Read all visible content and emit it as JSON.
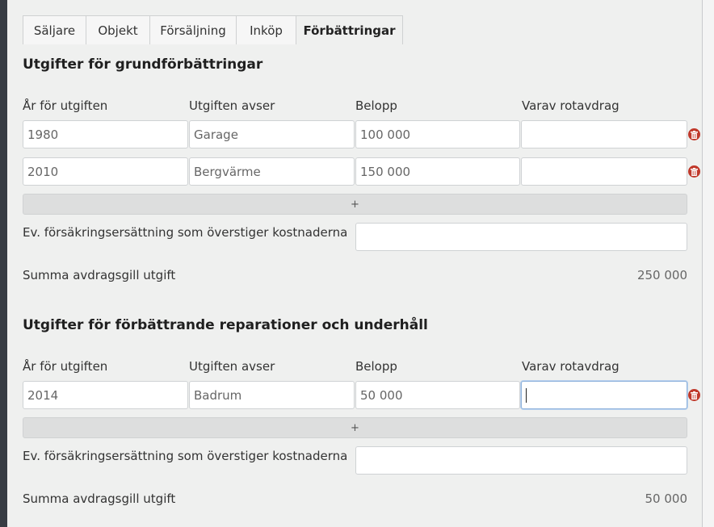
{
  "tabs": [
    {
      "label": "Säljare"
    },
    {
      "label": "Objekt"
    },
    {
      "label": "Försäljning"
    },
    {
      "label": "Inköp"
    },
    {
      "label": "Förbättringar",
      "active": true
    }
  ],
  "section1": {
    "title": "Utgifter för grundförbättringar",
    "col_year": "År för utgiften",
    "col_desc": "Utgiften avser",
    "col_amount": "Belopp",
    "col_rot": "Varav rotavdrag",
    "rows": [
      {
        "year": "1980",
        "desc": "Garage",
        "amount": "100 000",
        "rot": ""
      },
      {
        "year": "2010",
        "desc": "Bergvärme",
        "amount": "150 000",
        "rot": ""
      }
    ],
    "add_label": "+",
    "insurance_label": "Ev. försäkringsersättning som överstiger kostnaderna",
    "insurance_value": "",
    "sum_label": "Summa avdragsgill utgift",
    "sum_value": "250 000"
  },
  "section2": {
    "title": "Utgifter för förbättrande reparationer och underhåll",
    "col_year": "År för utgiften",
    "col_desc": "Utgiften avser",
    "col_amount": "Belopp",
    "col_rot": "Varav rotavdrag",
    "rows": [
      {
        "year": "2014",
        "desc": "Badrum",
        "amount": "50 000",
        "rot": ""
      }
    ],
    "add_label": "+",
    "insurance_label": "Ev. försäkringsersättning som överstiger kostnaderna",
    "insurance_value": "",
    "sum_label": "Summa avdragsgill utgift",
    "sum_value": "50 000"
  },
  "icons": {
    "delete": "trash-icon"
  },
  "colors": {
    "delete_red": "#c0392b",
    "focus_border": "#8fb3dc",
    "sidebar": "#373c43"
  }
}
